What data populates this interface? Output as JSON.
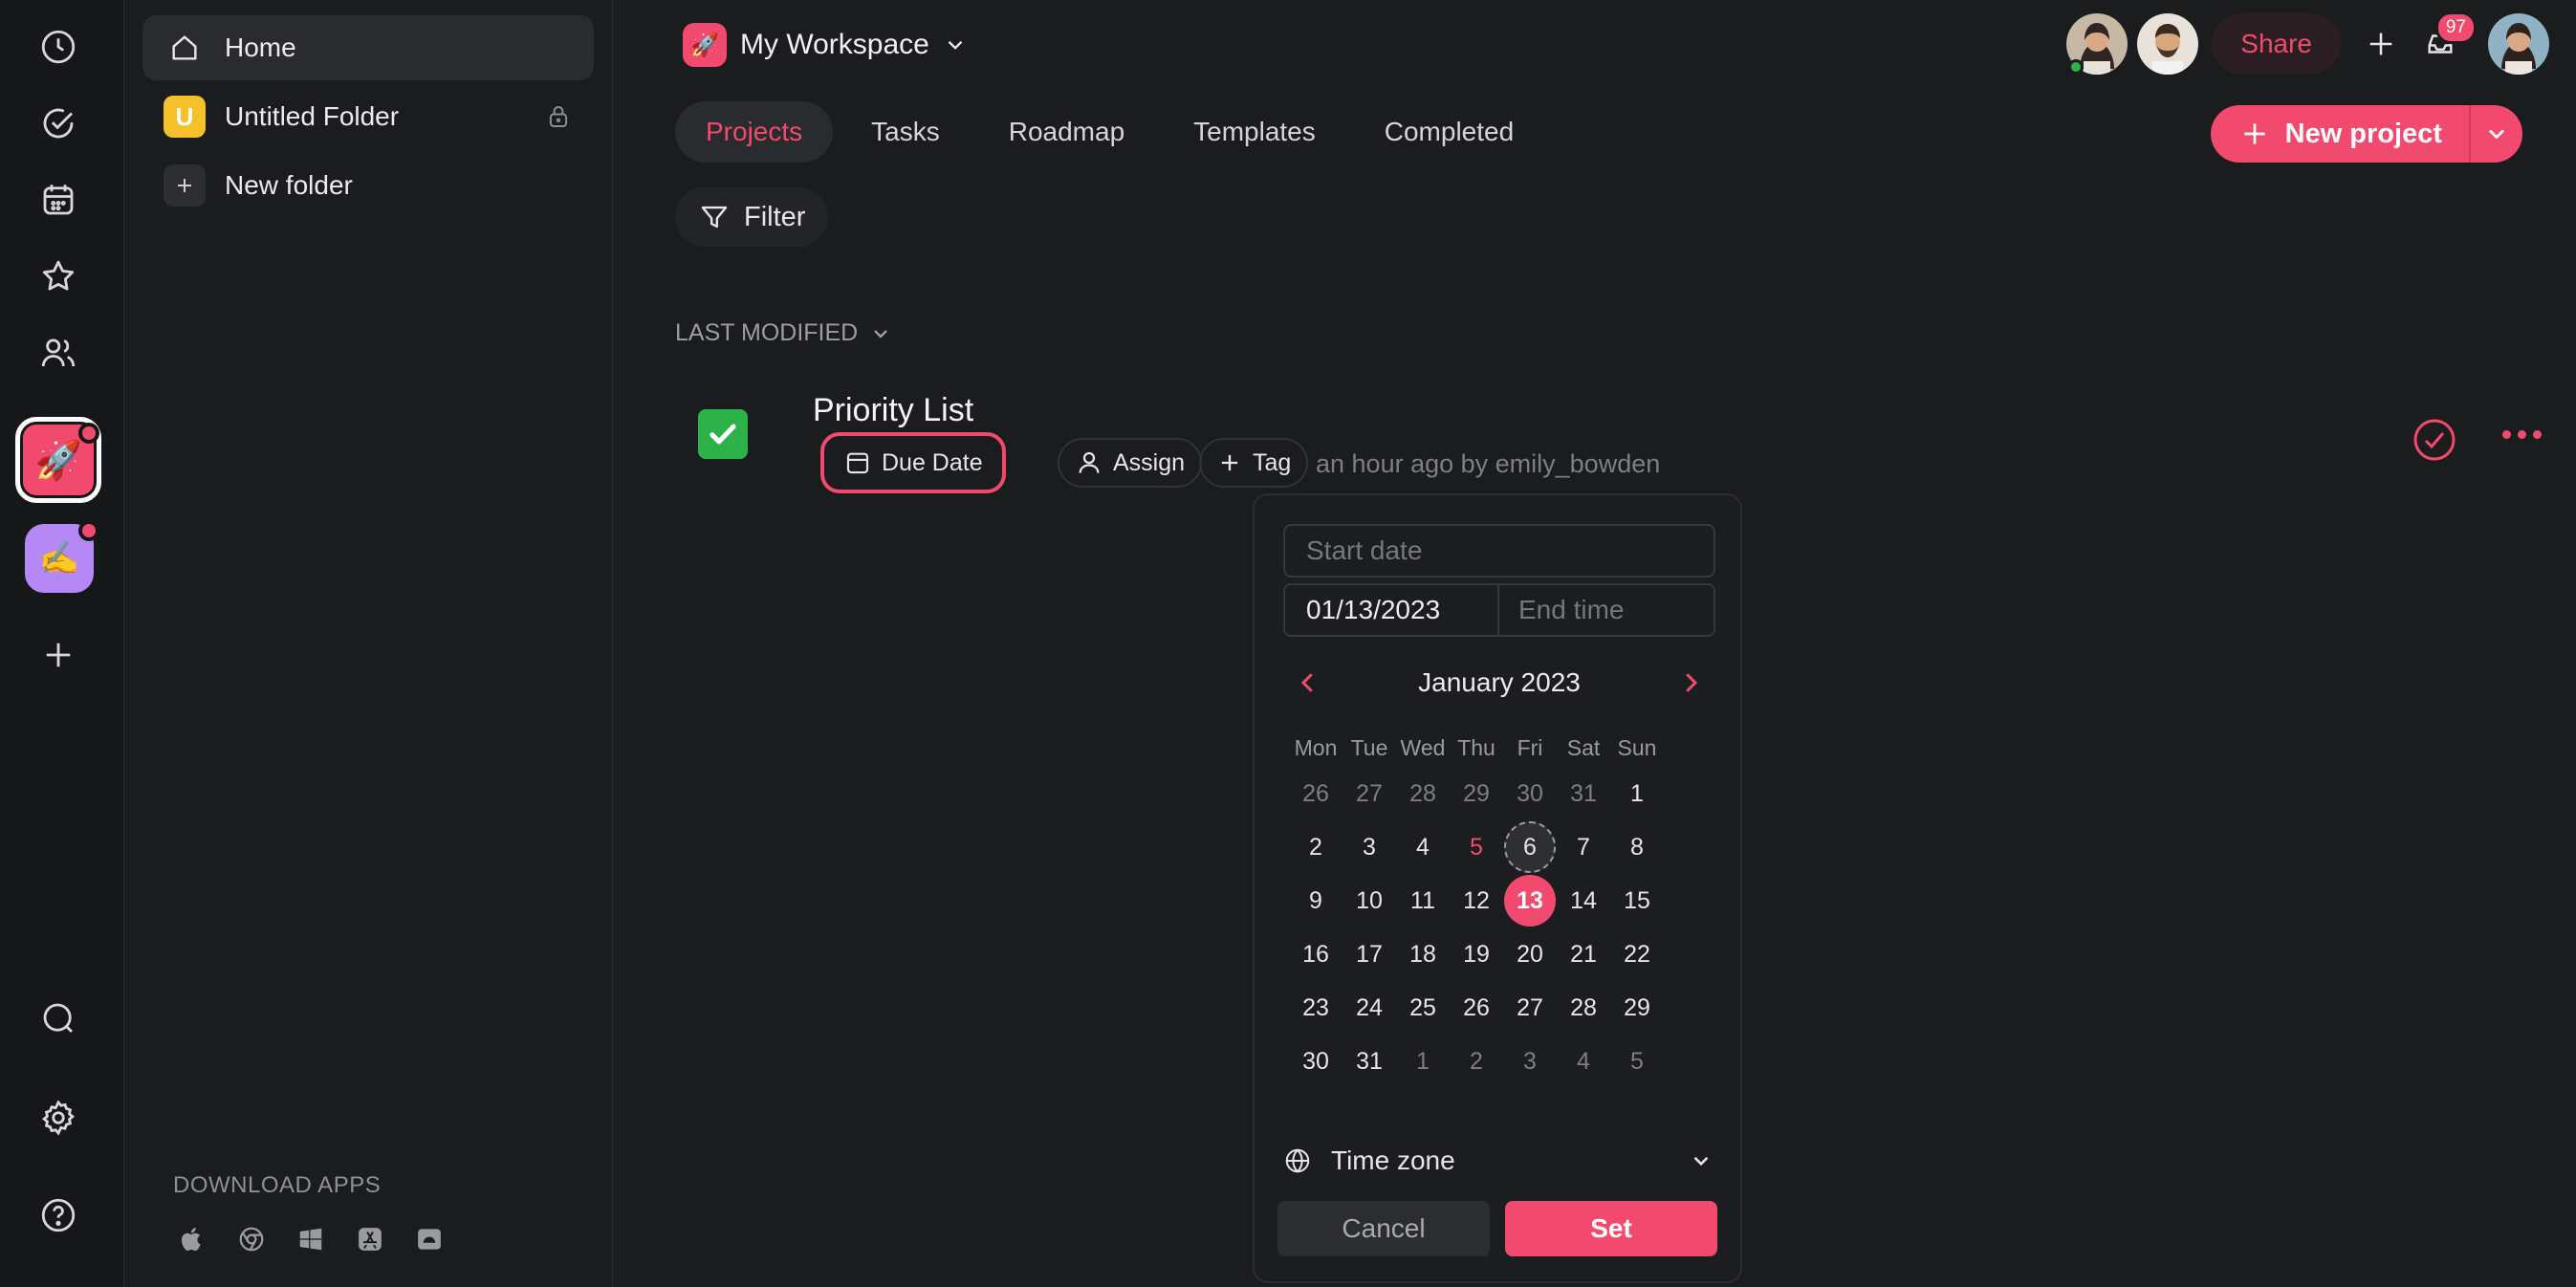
{
  "rail": {
    "ws_active_emoji": "🚀",
    "ws_second_emoji": "✍️"
  },
  "sidebar": {
    "items": [
      {
        "label": "Home"
      },
      {
        "label": "Untitled Folder",
        "badge_letter": "U"
      },
      {
        "label": "New folder"
      }
    ],
    "download_label": "DOWNLOAD APPS"
  },
  "header": {
    "workspace_emoji": "🚀",
    "workspace_name": "My Workspace",
    "share_label": "Share",
    "notification_count": "97"
  },
  "tabs": [
    {
      "label": "Projects",
      "active": true
    },
    {
      "label": "Tasks"
    },
    {
      "label": "Roadmap"
    },
    {
      "label": "Templates"
    },
    {
      "label": "Completed"
    }
  ],
  "new_project_label": "New project",
  "filter_label": "Filter",
  "sort_label": "LAST MODIFIED",
  "project": {
    "title": "Priority List",
    "due_label": "Due Date",
    "assign_label": "Assign",
    "tag_label": "Tag",
    "meta": "an hour ago by emily_bowden"
  },
  "date_picker": {
    "start_placeholder": "Start date",
    "end_date_value": "01/13/2023",
    "end_time_placeholder": "End time",
    "month_label": "January 2023",
    "weekdays": [
      "Mon",
      "Tue",
      "Wed",
      "Thu",
      "Fri",
      "Sat",
      "Sun"
    ],
    "days": [
      {
        "d": "26",
        "m": true
      },
      {
        "d": "27",
        "m": true
      },
      {
        "d": "28",
        "m": true
      },
      {
        "d": "29",
        "m": true
      },
      {
        "d": "30",
        "m": true
      },
      {
        "d": "31",
        "m": true
      },
      {
        "d": "1"
      },
      {
        "d": "2"
      },
      {
        "d": "3"
      },
      {
        "d": "4"
      },
      {
        "d": "5",
        "today": true
      },
      {
        "d": "6",
        "hover": true
      },
      {
        "d": "7"
      },
      {
        "d": "8"
      },
      {
        "d": "9"
      },
      {
        "d": "10"
      },
      {
        "d": "11"
      },
      {
        "d": "12"
      },
      {
        "d": "13",
        "selected": true
      },
      {
        "d": "14"
      },
      {
        "d": "15"
      },
      {
        "d": "16"
      },
      {
        "d": "17"
      },
      {
        "d": "18"
      },
      {
        "d": "19"
      },
      {
        "d": "20"
      },
      {
        "d": "21"
      },
      {
        "d": "22"
      },
      {
        "d": "23"
      },
      {
        "d": "24"
      },
      {
        "d": "25"
      },
      {
        "d": "26"
      },
      {
        "d": "27"
      },
      {
        "d": "28"
      },
      {
        "d": "29"
      },
      {
        "d": "30"
      },
      {
        "d": "31"
      },
      {
        "d": "1",
        "m": true
      },
      {
        "d": "2",
        "m": true
      },
      {
        "d": "3",
        "m": true
      },
      {
        "d": "4",
        "m": true
      },
      {
        "d": "5",
        "m": true
      }
    ],
    "timezone_label": "Time zone",
    "cancel_label": "Cancel",
    "set_label": "Set"
  },
  "colors": {
    "accent": "#f2496e",
    "background": "#1b1c1e"
  }
}
